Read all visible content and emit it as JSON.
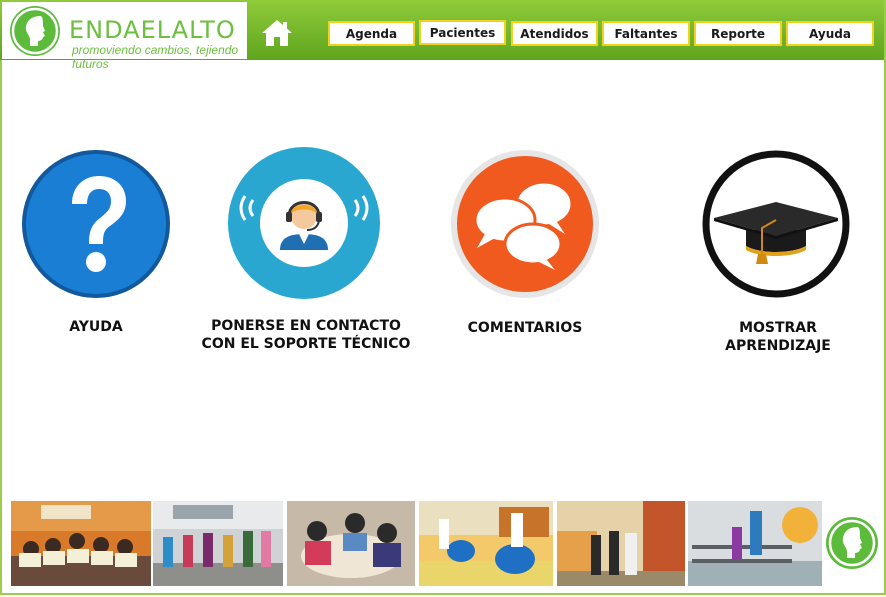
{
  "brand": {
    "name": "ENDAELALTO",
    "tagline": "promoviendo cambios, tejiendo futuros",
    "color": "#6cbf3e"
  },
  "nav": {
    "home_icon": "home-icon",
    "items": [
      {
        "label": "Agenda"
      },
      {
        "label": "Pacientes"
      },
      {
        "label": "Atendidos"
      },
      {
        "label": "Faltantes"
      },
      {
        "label": "Reporte"
      },
      {
        "label": "Ayuda"
      }
    ]
  },
  "tiles": [
    {
      "icon": "question-mark-icon",
      "label": "AYUDA"
    },
    {
      "icon": "support-agent-icon",
      "label_line1": "PONERSE EN CONTACTO",
      "label_line2": "CON EL SOPORTE TÉCNICO"
    },
    {
      "icon": "chat-bubbles-icon",
      "label": "COMENTARIOS"
    },
    {
      "icon": "graduation-cap-icon",
      "label": "MOSTRAR APRENDIZAJE"
    }
  ],
  "photos": [
    {
      "name": "photo-children-drawings"
    },
    {
      "name": "photo-children-running"
    },
    {
      "name": "photo-classroom-activity"
    },
    {
      "name": "photo-therapy-balls"
    },
    {
      "name": "photo-hallway-visitors"
    },
    {
      "name": "photo-parallel-bars-therapy"
    }
  ],
  "colors": {
    "header_green": "#6fb52a",
    "nav_border": "#f1d21f",
    "help_blue": "#1a7fd4",
    "support_teal": "#2aa7d0",
    "comments_orange": "#f05a1e",
    "learning_black": "#111111"
  }
}
